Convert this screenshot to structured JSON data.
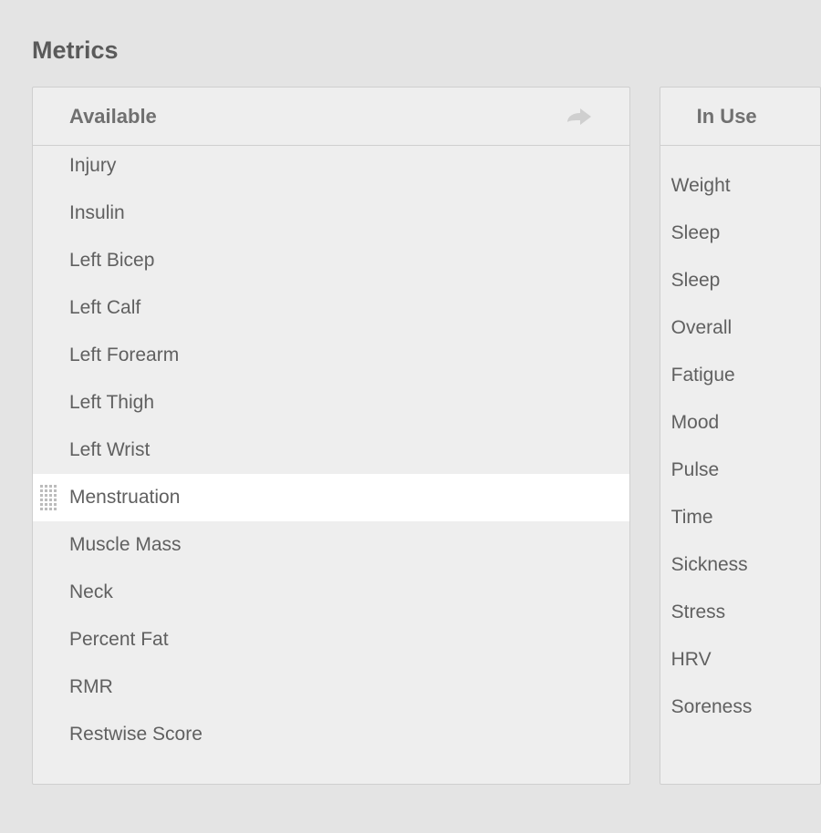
{
  "title": "Metrics",
  "panels": {
    "available": {
      "header": "Available",
      "items": [
        "Injury",
        "Insulin",
        "Left Bicep",
        "Left Calf",
        "Left Forearm",
        "Left Thigh",
        "Left Wrist",
        "Menstruation",
        "Muscle Mass",
        "Neck",
        "Percent Fat",
        "RMR",
        "Restwise Score"
      ],
      "highlighted_index": 7
    },
    "in_use": {
      "header": "In Use",
      "items": [
        "Weight",
        "Sleep",
        "Sleep",
        "Overall",
        "Fatigue",
        "Mood",
        "Pulse",
        "Time",
        "Sickness",
        "Stress",
        "HRV",
        "Soreness"
      ]
    }
  }
}
